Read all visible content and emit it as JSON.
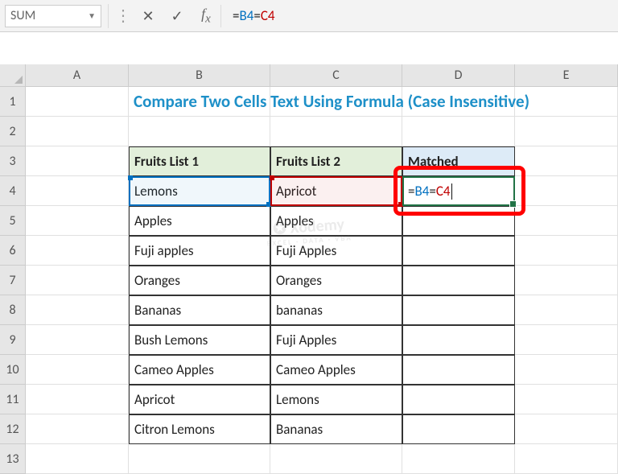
{
  "name_box": "SUM",
  "formula_bar": {
    "prefix": "=",
    "ref1": "B4",
    "mid": "=",
    "ref2": "C4"
  },
  "columns": [
    "A",
    "B",
    "C",
    "D",
    "E"
  ],
  "rows": [
    "1",
    "2",
    "3",
    "4",
    "5",
    "6",
    "7",
    "8",
    "9",
    "10",
    "11",
    "12",
    "13"
  ],
  "title": "Compare Two Cells Text Using Formula (Case Insensitive)",
  "headers": {
    "b": "Fruits List 1",
    "c": "Fruits List 2",
    "d": "Matched"
  },
  "table": [
    {
      "b": "Lemons",
      "c": "Apricot",
      "d_formula": true
    },
    {
      "b": "Apples",
      "c": "Apples",
      "d": ""
    },
    {
      "b": "Fuji apples",
      "c": "Fuji Apples",
      "d": ""
    },
    {
      "b": "Oranges",
      "c": "Oranges",
      "d": ""
    },
    {
      "b": "Bananas",
      "c": "bananas",
      "d": ""
    },
    {
      "b": "Bush Lemons",
      "c": "Fuji Apples",
      "d": ""
    },
    {
      "b": "Cameo Apples",
      "c": "Cameo Apples",
      "d": ""
    },
    {
      "b": "Apricot",
      "c": "Lemons",
      "d": ""
    },
    {
      "b": "Citron Lemons",
      "c": "Bananas",
      "d": ""
    }
  ],
  "watermark": {
    "line1": "✪ Xodemy",
    "line2": "EXCEL · DATA · VBA"
  }
}
